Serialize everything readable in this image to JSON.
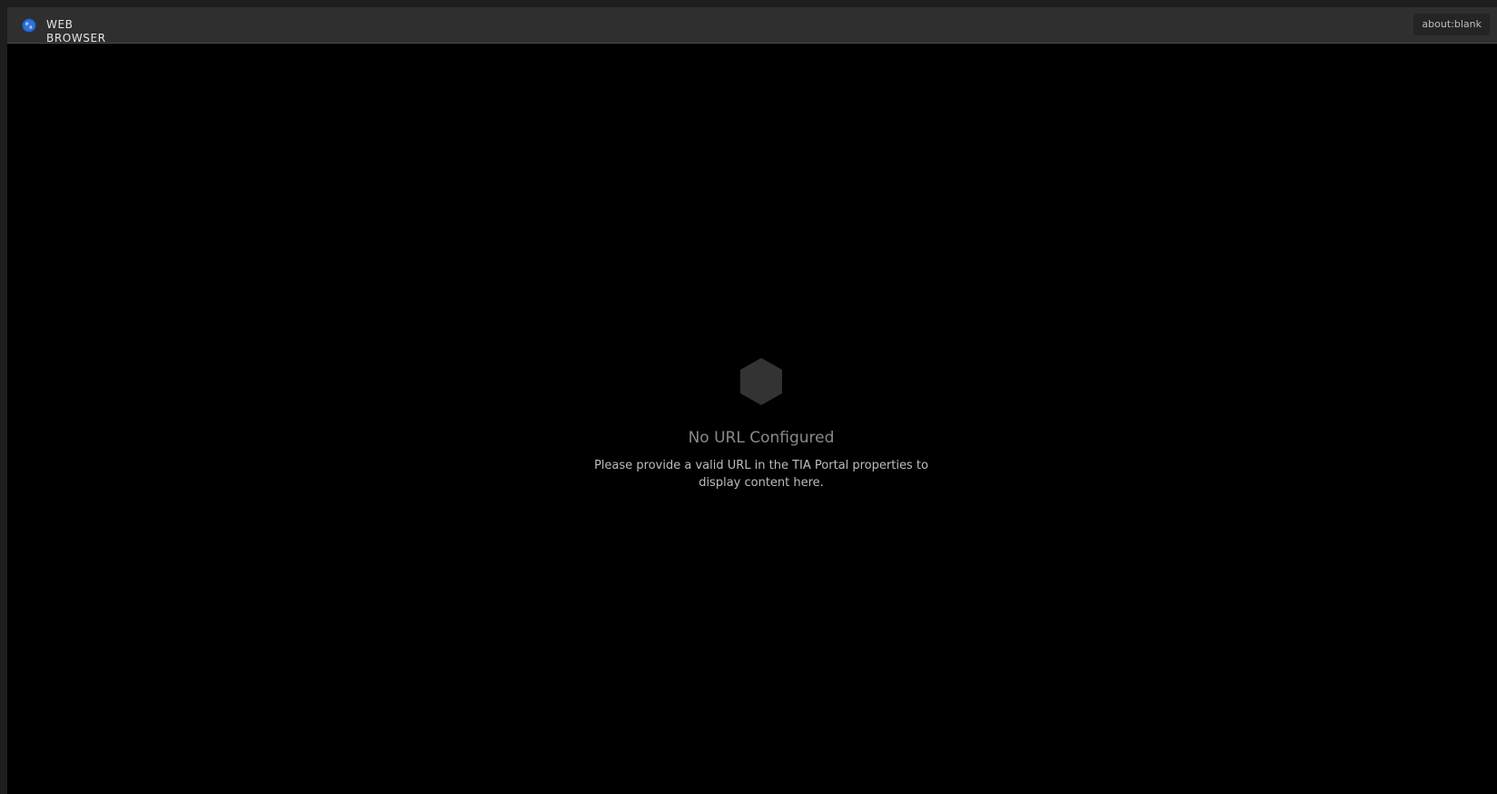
{
  "window": {
    "title_line1": "WEB",
    "title_line2": "BROWSER",
    "icon": "globe-icon",
    "url": "about:blank"
  },
  "empty_state": {
    "icon": "hexagon-icon",
    "title": "No URL Configured",
    "description": "Please provide a valid URL in the TIA Portal properties to display content here."
  },
  "colors": {
    "titlebar": "#2f2f2f",
    "content_background": "#000000",
    "accent_globe": "#2f6fd6",
    "hexagon": "#333333"
  }
}
